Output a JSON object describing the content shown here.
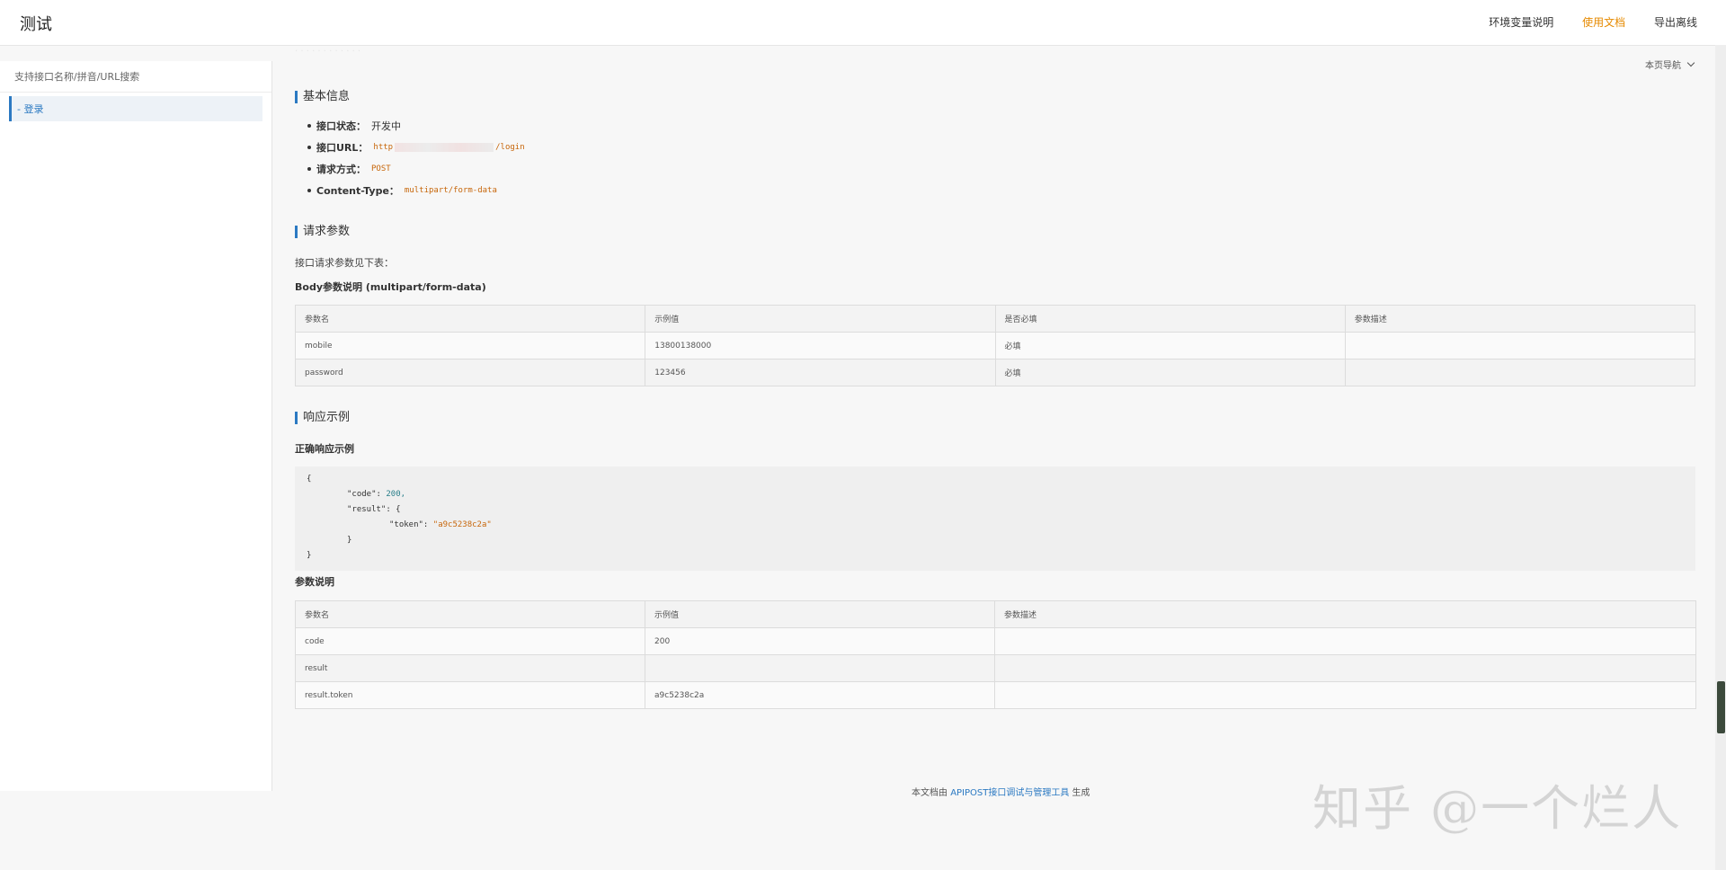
{
  "header": {
    "title": "测试",
    "nav": [
      "环境变量说明",
      "使用文档",
      "导出离线"
    ],
    "active_nav": "使用文档"
  },
  "sidebar": {
    "search_placeholder": "支持接口名称/拼音/URL搜索",
    "items": [
      {
        "label": "- 登录"
      }
    ]
  },
  "page_nav": "本页导航",
  "basic": {
    "title": "基本信息",
    "items": [
      {
        "label": "接口状态：",
        "value": "开发中"
      },
      {
        "label": "接口URL：",
        "prefix": "http",
        "suffix": "/login"
      },
      {
        "label": "请求方式：",
        "value": "POST"
      },
      {
        "label": "Content-Type：",
        "value": "multipart/form-data"
      }
    ]
  },
  "request": {
    "title": "请求参数",
    "intro": "接口请求参数见下表：",
    "body_label": "Body参数说明 (multipart/form-data)",
    "headers": [
      "参数名",
      "示例值",
      "是否必填",
      "参数描述"
    ],
    "rows": [
      [
        "mobile",
        "13800138000",
        "必填",
        ""
      ],
      [
        "password",
        "123456",
        "必填",
        ""
      ]
    ]
  },
  "response": {
    "title": "响应示例",
    "ok_label": "正确响应示例",
    "code": {
      "open": "{",
      "code_key": "\"code\": ",
      "code_val": "200,",
      "result_key": "\"result\": {",
      "token_key": "\"token\": ",
      "token_val": "\"a9c5238c2a\"",
      "inner_close": "}",
      "close": "}"
    },
    "param_label": "参数说明",
    "headers": [
      "参数名",
      "示例值",
      "参数描述"
    ],
    "rows": [
      [
        "code",
        "200",
        ""
      ],
      [
        "result",
        "",
        ""
      ],
      [
        "result.token",
        "a9c5238c2a",
        ""
      ]
    ]
  },
  "footer": {
    "pre": "本文档由 ",
    "link": "APIPOST接口调试与管理工具",
    "post": " 生成"
  },
  "watermark": "知乎 @一个烂人"
}
